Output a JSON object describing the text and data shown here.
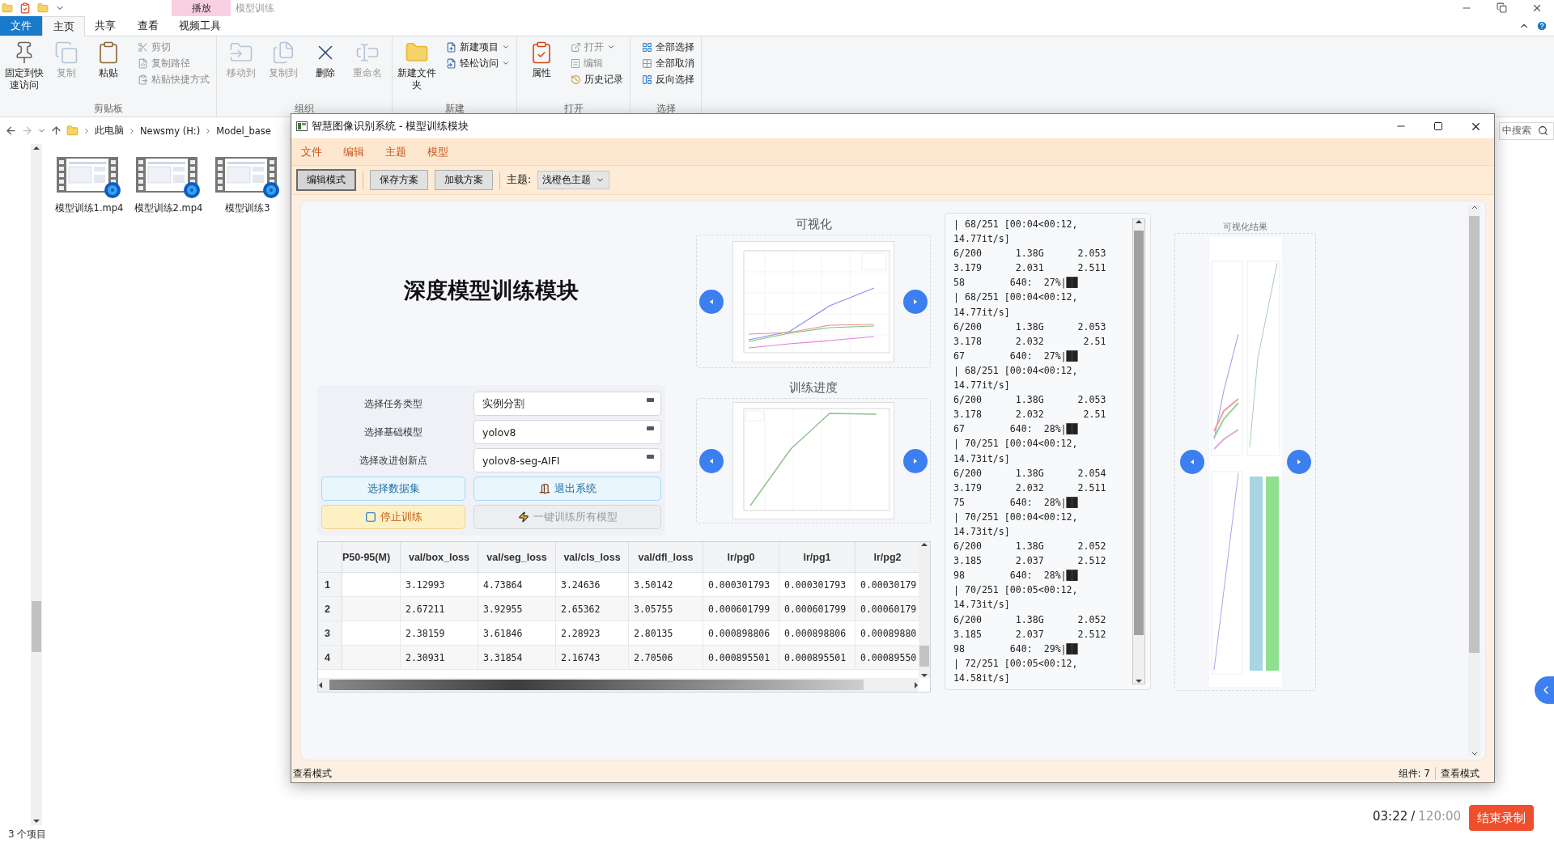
{
  "explorer": {
    "title": "模型训练",
    "context_tab": {
      "group": "播放",
      "label": "视频工具",
      "selected": false
    },
    "tabs": [
      {
        "label": "文件",
        "kind": "file",
        "selected": false
      },
      {
        "label": "主页",
        "kind": "plain",
        "selected": true
      },
      {
        "label": "共享",
        "kind": "plain",
        "selected": false
      },
      {
        "label": "查看",
        "kind": "plain",
        "selected": false
      }
    ],
    "ribbon_groups": [
      {
        "label": "剪贴板",
        "items": [
          {
            "label": "固定到快速访问",
            "kind": "large",
            "disabled": false
          },
          {
            "label": "复制",
            "kind": "large",
            "disabled": true
          },
          {
            "label": "粘贴",
            "kind": "large",
            "disabled": false
          },
          {
            "label": "剪切",
            "kind": "small",
            "disabled": true
          },
          {
            "label": "复制路径",
            "kind": "small",
            "disabled": true
          },
          {
            "label": "粘贴快捷方式",
            "kind": "small",
            "disabled": true
          }
        ]
      },
      {
        "label": "组织",
        "items": [
          {
            "label": "移动到",
            "kind": "large",
            "disabled": true
          },
          {
            "label": "复制到",
            "kind": "large",
            "disabled": true
          },
          {
            "label": "删除",
            "kind": "large",
            "disabled": false
          },
          {
            "label": "重命名",
            "kind": "large",
            "disabled": true
          }
        ]
      },
      {
        "label": "新建",
        "items": [
          {
            "label": "新建文件夹",
            "kind": "large",
            "disabled": false
          },
          {
            "label": "新建项目",
            "kind": "small",
            "disabled": false
          },
          {
            "label": "轻松访问",
            "kind": "small",
            "disabled": false
          }
        ]
      },
      {
        "label": "打开",
        "items": [
          {
            "label": "属性",
            "kind": "large",
            "disabled": false
          },
          {
            "label": "打开",
            "kind": "small",
            "disabled": true
          },
          {
            "label": "编辑",
            "kind": "small",
            "disabled": true
          },
          {
            "label": "历史记录",
            "kind": "small",
            "disabled": false
          }
        ]
      },
      {
        "label": "选择",
        "items": [
          {
            "label": "全部选择",
            "kind": "small",
            "disabled": false
          },
          {
            "label": "全部取消",
            "kind": "small",
            "disabled": false
          },
          {
            "label": "反向选择",
            "kind": "small",
            "disabled": false
          }
        ]
      }
    ],
    "path": [
      "此电脑",
      "Newsmy (H:)",
      "Model_base"
    ],
    "search_placeholder": "中搜索",
    "files": [
      "模型训练1.mp4",
      "模型训练2.mp4",
      "模型训练3"
    ],
    "status": "3 个项目"
  },
  "app": {
    "title": "智慧图像识别系统 - 模型训练模块",
    "menu": [
      "文件",
      "编辑",
      "主题",
      "模型"
    ],
    "toolbar": {
      "buttons": [
        {
          "label": "编辑模式",
          "selected": true
        },
        {
          "label": "保存方案",
          "selected": false
        },
        {
          "label": "加载方案",
          "selected": false
        }
      ],
      "theme_label": "主题:",
      "theme_value": "浅橙色主题"
    },
    "heading": "深度模型训练模块",
    "fields": [
      {
        "label": "选择任务类型",
        "value": "实例分割"
      },
      {
        "label": "选择基础模型",
        "value": "yolov8"
      },
      {
        "label": "选择改进创新点",
        "value": "yolov8-seg-AIFI"
      }
    ],
    "actions": [
      {
        "label": "选择数据集",
        "kind": "primary",
        "disabled": false
      },
      {
        "label": "退出系统",
        "kind": "primary",
        "disabled": false
      },
      {
        "label": "停止训练",
        "kind": "warning",
        "disabled": false
      },
      {
        "label": "一键训练所有模型",
        "kind": "neutral",
        "disabled": true
      }
    ],
    "charts": [
      {
        "title": "可视化"
      },
      {
        "title": "训练进度"
      }
    ],
    "table": {
      "columns": [
        "P50-95(M)",
        "val/box_loss",
        "val/seg_loss",
        "val/cls_loss",
        "val/dfl_loss",
        "lr/pg0",
        "lr/pg1",
        "lr/pg2"
      ],
      "rows": [
        {
          "index": "1",
          "cells": [
            "",
            "3.12993",
            "4.73864",
            "3.24636",
            "3.50142",
            "0.000301793",
            "0.000301793",
            "0.00030179"
          ]
        },
        {
          "index": "2",
          "cells": [
            "",
            "2.67211",
            "3.92955",
            "2.65362",
            "3.05755",
            "0.000601799",
            "0.000601799",
            "0.00060179"
          ]
        },
        {
          "index": "3",
          "cells": [
            "",
            "2.38159",
            "3.61846",
            "2.28923",
            "2.80135",
            "0.000898806",
            "0.000898806",
            "0.00089880"
          ]
        },
        {
          "index": "4",
          "cells": [
            "",
            "2.30931",
            "3.31854",
            "2.16743",
            "2.70506",
            "0.000895501",
            "0.000895501",
            "0.00089550"
          ]
        }
      ]
    },
    "log": [
      "| 68/251 [00:04<00:12,",
      "14.77it/s]",
      "6/200      1.38G      2.053",
      "3.179      2.031      2.511",
      "58        640:  27%|██",
      "| 68/251 [00:04<00:12,",
      "14.77it/s]",
      "6/200      1.38G      2.053",
      "3.178      2.032       2.51",
      "67        640:  27%|██",
      "| 68/251 [00:04<00:12,",
      "14.77it/s]",
      "6/200      1.38G      2.053",
      "3.178      2.032       2.51",
      "67        640:  28%|██",
      "| 70/251 [00:04<00:12,",
      "14.73it/s]",
      "6/200      1.38G      2.054",
      "3.179      2.032      2.511",
      "75        640:  28%|██",
      "| 70/251 [00:04<00:12,",
      "14.73it/s]",
      "6/200      1.38G      2.052",
      "3.185      2.037      2.512",
      "98        640:  28%|██",
      "| 70/251 [00:05<00:12,",
      "14.73it/s]",
      "6/200      1.38G      2.052",
      "3.185      2.037      2.512",
      "98        640:  29%|██",
      "| 72/251 [00:05<00:12,",
      "14.58it/s]"
    ],
    "result": {
      "title": "可视化结果"
    },
    "status_bar": {
      "mode": "查看模式",
      "components": "组件: 7",
      "right_mode": "查看模式"
    }
  },
  "recorder": {
    "elapsed": "03:22",
    "separator": "/",
    "total": "120:00",
    "stop_button": "结束录制"
  }
}
